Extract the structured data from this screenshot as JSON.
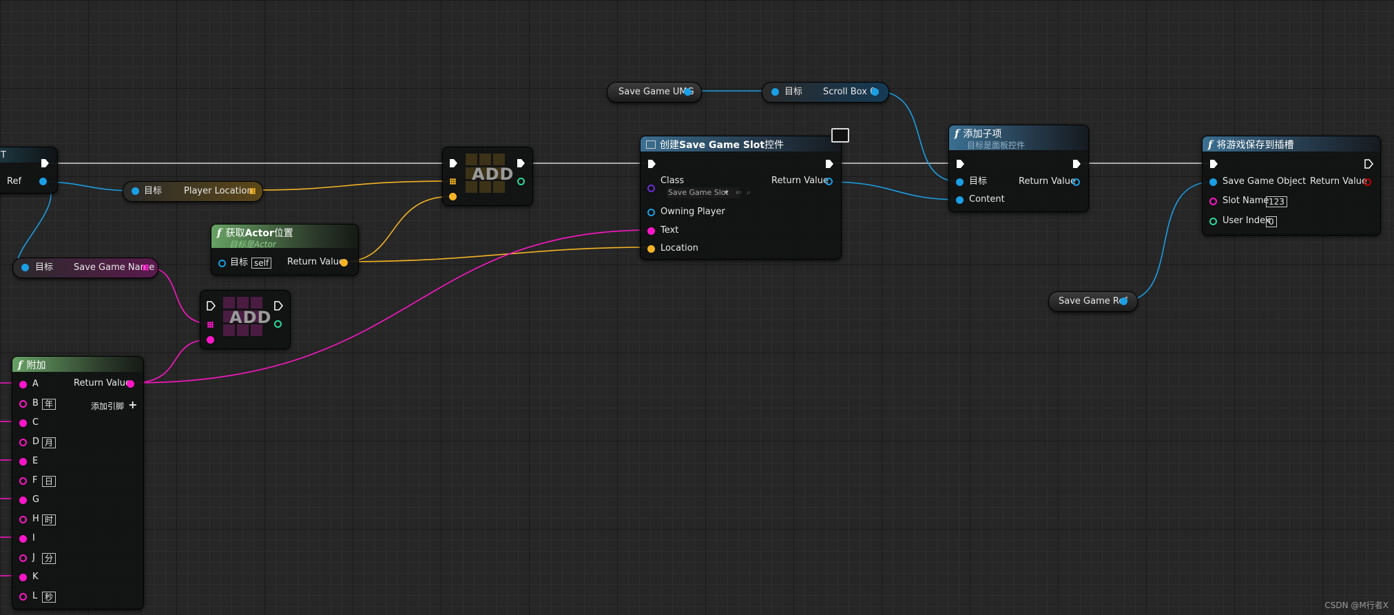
{
  "colors": {
    "exec": "#ffffff",
    "object": "#1a9fe5",
    "vector": "#f5b424",
    "string": "#ff16c8",
    "int": "#29d99a",
    "class": "#6a2fd6",
    "bool": "#c20000"
  },
  "node_left_edge": {
    "title": "T",
    "ref_label": "Ref"
  },
  "var_player_location": {
    "target": "目标",
    "name": "Player Location"
  },
  "var_save_game_name": {
    "target": "目标",
    "name": "Save Game Name"
  },
  "node_get_actor_location": {
    "title_prefix": "获取",
    "title_bold": "Actor",
    "title_suffix": "位置",
    "subtitle": "目标是Actor",
    "target": "目标",
    "target_value": "self",
    "return": "Return Value"
  },
  "node_add_vector": {
    "label": "ADD"
  },
  "node_add_string": {
    "label": "ADD"
  },
  "node_append": {
    "title": "附加",
    "return": "Return Value",
    "add_pin": "添加引脚",
    "pins": [
      {
        "name": "A",
        "value": ""
      },
      {
        "name": "B",
        "value": "年"
      },
      {
        "name": "C",
        "value": ""
      },
      {
        "name": "D",
        "value": "月"
      },
      {
        "name": "E",
        "value": ""
      },
      {
        "name": "F",
        "value": "日"
      },
      {
        "name": "G",
        "value": ""
      },
      {
        "name": "H",
        "value": "时"
      },
      {
        "name": "I",
        "value": ""
      },
      {
        "name": "J",
        "value": "分"
      },
      {
        "name": "K",
        "value": ""
      },
      {
        "name": "L",
        "value": "秒"
      }
    ]
  },
  "var_save_game_umg": {
    "name": "Save Game UMG"
  },
  "node_scroll_box": {
    "target": "目标",
    "name": "Scroll Box 0"
  },
  "node_create_widget": {
    "title_prefix": "创建",
    "title_bold": "Save Game Slot",
    "title_suffix": "控件",
    "class": "Class",
    "class_value": "Save Game Slot",
    "return": "Return Value",
    "owning_player": "Owning Player",
    "text": "Text",
    "location": "Location"
  },
  "node_add_child": {
    "title": "添加子项",
    "subtitle": "目标是面板控件",
    "target": "目标",
    "return": "Return Value",
    "content": "Content"
  },
  "node_save_game": {
    "title": "将游戏保存到插槽",
    "save_object": "Save Game Object",
    "return": "Return Value",
    "slot_name": "Slot Name",
    "slot_value": "123",
    "user_index": "User Index",
    "user_value": "0"
  },
  "var_save_game_ref": {
    "name": "Save Game Ref"
  },
  "watermark": "CSDN @M行者X"
}
